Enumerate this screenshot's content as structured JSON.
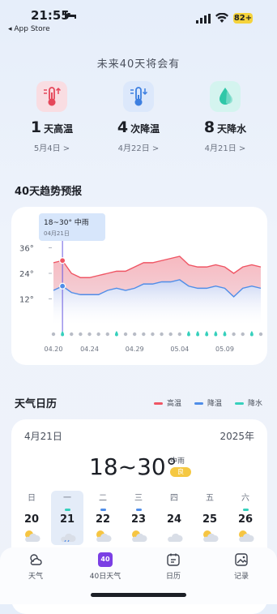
{
  "status_bar": {
    "time": "21:55",
    "back_label": "◂ App Store",
    "battery": "82+"
  },
  "future": {
    "title": "未来40天将会有",
    "stats": [
      {
        "number": "1",
        "label": "天高温",
        "date": "5月4日 >"
      },
      {
        "number": "4",
        "label": "次降温",
        "date": "4月22日 >"
      },
      {
        "number": "8",
        "label": "天降水",
        "date": "4月21日 >"
      }
    ]
  },
  "trend": {
    "title": "40天趋势预报",
    "tooltip": {
      "temp": "18~30°  中雨",
      "date": "04月21日"
    }
  },
  "chart_data": {
    "type": "area",
    "y_ticks": [
      "36°",
      "24°",
      "12°"
    ],
    "ylim": [
      0,
      40
    ],
    "x_ticks": [
      "04.20",
      "04.24",
      "04.29",
      "05.04",
      "05.09"
    ],
    "x": [
      "04.20",
      "04.21",
      "04.22",
      "04.23",
      "04.24",
      "04.25",
      "04.26",
      "04.27",
      "04.28",
      "04.29",
      "04.30",
      "05.01",
      "05.02",
      "05.03",
      "05.04",
      "05.05",
      "05.06",
      "05.07",
      "05.08",
      "05.09",
      "05.10",
      "05.11",
      "05.12",
      "05.13"
    ],
    "series": [
      {
        "name": "高温",
        "values": [
          29,
          30,
          24,
          22,
          22,
          23,
          24,
          25,
          25,
          27,
          29,
          29,
          30,
          31,
          32,
          28,
          27,
          27,
          28,
          27,
          24,
          27,
          28,
          27
        ]
      },
      {
        "name": "降温",
        "values": [
          16,
          18,
          15,
          14,
          14,
          14,
          16,
          17,
          16,
          17,
          19,
          19,
          20,
          20,
          21,
          18,
          17,
          17,
          18,
          17,
          13,
          17,
          18,
          17
        ]
      }
    ],
    "rain_days": [
      1,
      7,
      15,
      16,
      17,
      18,
      19,
      22
    ],
    "selected_index": 1,
    "colors": {
      "high": "#ef5564",
      "low": "#4f8de8",
      "rain": "#36d0bc",
      "dry": "#b8bcc6"
    }
  },
  "calendar": {
    "title": "天气日历",
    "legend": [
      "高温",
      "降温",
      "降水"
    ],
    "date": "4月21日",
    "year": "2025年",
    "temp": "18~30°",
    "condition": "中雨",
    "badge": "良",
    "weekdays": [
      "日",
      "一",
      "二",
      "三",
      "四",
      "五",
      "六"
    ],
    "days": [
      "20",
      "21",
      "22",
      "23",
      "24",
      "25",
      "26"
    ]
  },
  "tabbar": {
    "tabs": [
      {
        "label": "天气"
      },
      {
        "label": "40日天气",
        "icon_text": "40"
      },
      {
        "label": "日历"
      },
      {
        "label": "记录"
      }
    ]
  }
}
